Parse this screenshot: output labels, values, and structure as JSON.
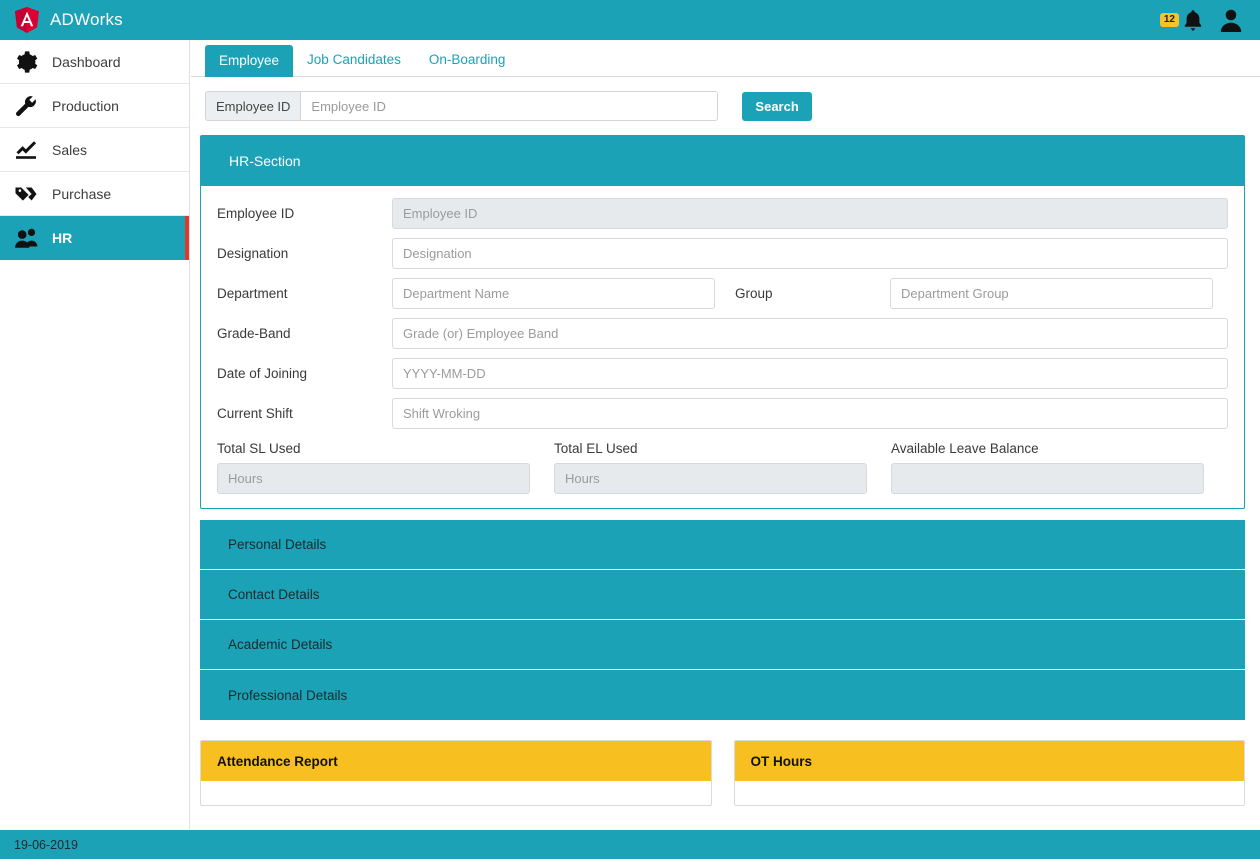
{
  "app": {
    "brand_name": "ADWorks",
    "logo_icon": "angular-shield-icon"
  },
  "topbar": {
    "notification_count": "12",
    "bell_icon": "bell-icon",
    "user_icon": "user-avatar-icon",
    "background_color": "#1ca2b7"
  },
  "sidebar": {
    "items": [
      {
        "label": "Dashboard",
        "icon": "gear-icon",
        "active": false
      },
      {
        "label": "Production",
        "icon": "wrench-icon",
        "active": false
      },
      {
        "label": "Sales",
        "icon": "trending-up-icon",
        "active": false
      },
      {
        "label": "Purchase",
        "icon": "tags-icon",
        "active": false
      },
      {
        "label": "HR",
        "icon": "people-icon",
        "active": true
      }
    ],
    "active_accent_color": "#e8352c"
  },
  "tabs": [
    {
      "label": "Employee",
      "active": true
    },
    {
      "label": "Job Candidates",
      "active": false
    },
    {
      "label": "On-Boarding",
      "active": false
    }
  ],
  "search": {
    "addon_label": "Employee ID",
    "placeholder": "Employee ID",
    "value": "",
    "button_label": "Search"
  },
  "hr_section": {
    "title": "HR-Section",
    "fields": [
      {
        "label": "Employee ID",
        "placeholder": "Employee ID",
        "value": "",
        "disabled": true
      },
      {
        "label": "Designation",
        "placeholder": "Designation",
        "value": "",
        "disabled": false
      },
      {
        "label": "Grade-Band",
        "placeholder": "Grade (or) Employee Band",
        "value": "",
        "disabled": false
      },
      {
        "label": "Date of Joining",
        "placeholder": "YYYY-MM-DD",
        "value": "",
        "disabled": false
      },
      {
        "label": "Current Shift",
        "placeholder": "Shift Wroking",
        "value": "",
        "disabled": false
      }
    ],
    "department": {
      "label": "Department",
      "placeholder": "Department Name",
      "value": ""
    },
    "group": {
      "label": "Group",
      "placeholder": "Department Group",
      "value": ""
    },
    "leave": [
      {
        "label": "Total SL Used",
        "placeholder": "Hours",
        "value": "",
        "disabled": true
      },
      {
        "label": "Total EL Used",
        "placeholder": "Hours",
        "value": "",
        "disabled": true
      },
      {
        "label": "Available Leave Balance",
        "placeholder": "",
        "value": "",
        "disabled": true
      }
    ]
  },
  "accordion": [
    {
      "label": "Personal Details"
    },
    {
      "label": "Contact Details"
    },
    {
      "label": "Academic Details"
    },
    {
      "label": "Professional Details"
    }
  ],
  "cards": [
    {
      "title": "Attendance Report"
    },
    {
      "title": "OT Hours"
    }
  ],
  "footer": {
    "date": "19-06-2019"
  },
  "colors": {
    "teal": "#1ca2b7",
    "amber": "#f7bf20",
    "red_accent": "#e8352c",
    "badge_yellow": "#f7c12b"
  }
}
